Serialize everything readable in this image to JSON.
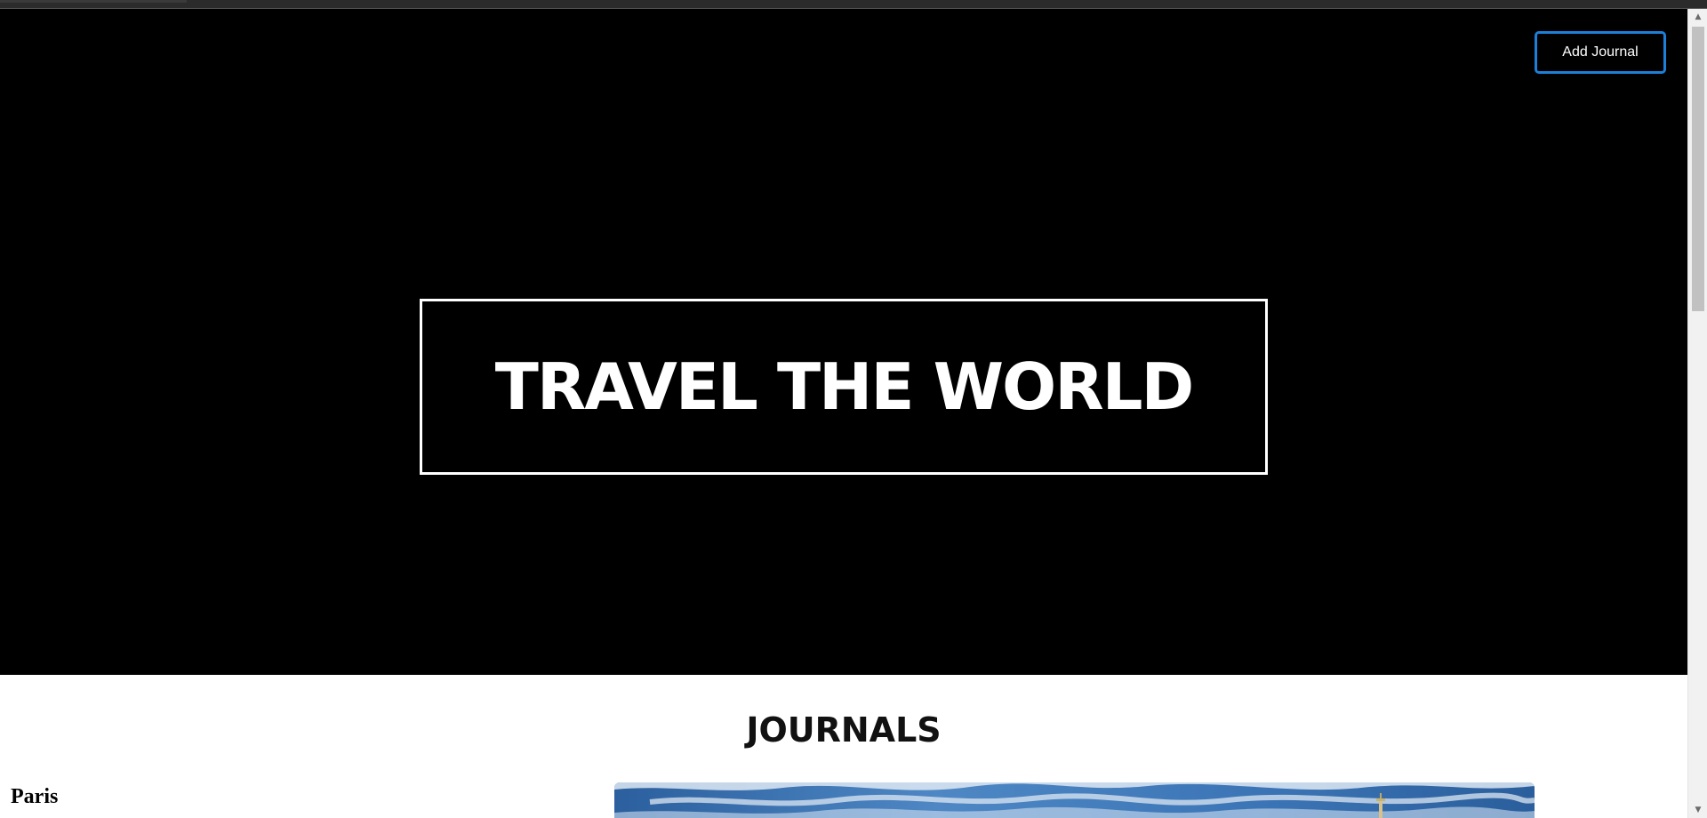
{
  "header": {
    "add_journal_label": "Add Journal"
  },
  "hero": {
    "title": "TRAVEL THE WORLD"
  },
  "journals": {
    "heading": "JOURNALS",
    "items": [
      {
        "title": "Paris",
        "image_icon": "eiffel-tower-photo"
      }
    ]
  },
  "colors": {
    "hero_background": "#000000",
    "button_border": "#1e7fd8",
    "page_background": "#ffffff"
  },
  "icons": {
    "scroll_up": "▲",
    "scroll_down": "▼"
  }
}
